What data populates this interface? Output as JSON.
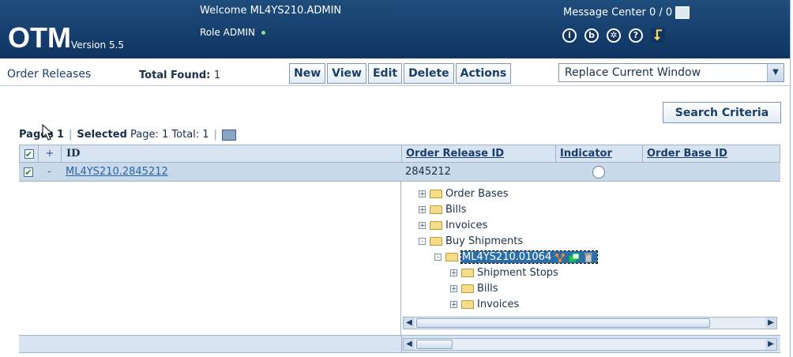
{
  "header": {
    "logo": "OTM",
    "version": "Version 5.5",
    "welcome": "Welcome ML4YS210.ADMIN",
    "role": "Role ADMIN",
    "message_center": "Message Center  0 / 0",
    "icons": [
      "info-icon",
      "bookmark-icon",
      "settings-icon",
      "help-icon",
      "exit-icon"
    ]
  },
  "toolbar": {
    "title": "Order Releases",
    "total_label": "Total Found:",
    "total_value": "1",
    "buttons": {
      "new": "New",
      "view": "View",
      "edit": "Edit",
      "delete": "Delete",
      "actions": "Actions"
    },
    "window_select": "Replace Current Window"
  },
  "search_criteria": "Search Criteria",
  "paging": {
    "pages_label": "Pages",
    "pages_value": "1",
    "selected_label": "Selected",
    "selected_text": "Page: 1  Total: 1"
  },
  "grid": {
    "headers": {
      "plus": "+",
      "id": "ID",
      "order_release_id": "Order Release ID",
      "indicator": "Indicator",
      "order_base_id": "Order Base ID"
    },
    "row": {
      "checked": "✔",
      "minus": "-",
      "id": "ML4YS210.2845212",
      "order_release_id": "2845212"
    }
  },
  "tree": [
    {
      "label": "Order Bases",
      "level": 0,
      "toggle": "+"
    },
    {
      "label": "Bills",
      "level": 0,
      "toggle": "+"
    },
    {
      "label": "Invoices",
      "level": 0,
      "toggle": "+"
    },
    {
      "label": "Buy Shipments",
      "level": 0,
      "toggle": "-"
    },
    {
      "label": "ML4YS210.01064",
      "level": 1,
      "toggle": "-",
      "selected": true
    },
    {
      "label": "Shipment Stops",
      "level": 2,
      "toggle": "+"
    },
    {
      "label": "Bills",
      "level": 2,
      "toggle": "+"
    },
    {
      "label": "Invoices",
      "level": 2,
      "toggle": "+"
    }
  ],
  "colors": {
    "header_bg": "#1f4d7c",
    "grid_header": "#d7e3f0",
    "row_selected": "#cad9ea",
    "link": "#2764a8"
  }
}
